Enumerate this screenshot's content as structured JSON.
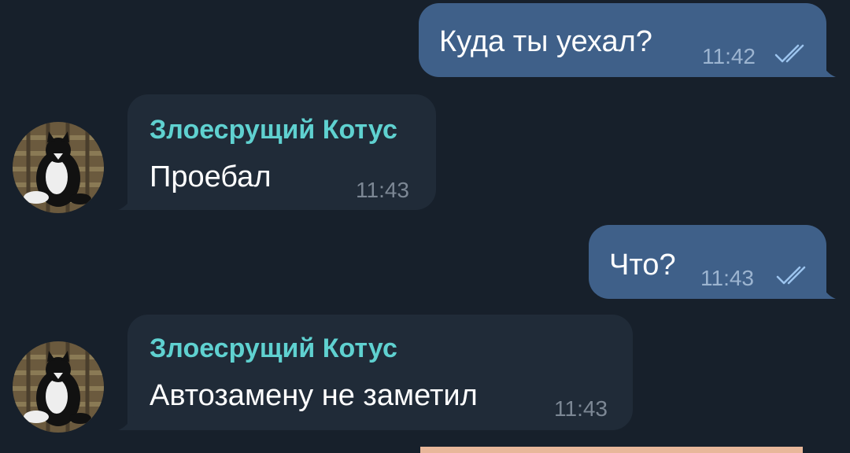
{
  "messages": [
    {
      "direction": "outgoing",
      "text": "Куда ты уехал?",
      "time": "11:42",
      "status": "read"
    },
    {
      "direction": "incoming",
      "sender": "Злоесрущий Котус",
      "text": "Проебал",
      "time": "11:43",
      "avatar_icon": "cat-avatar-icon"
    },
    {
      "direction": "outgoing",
      "text": "Что?",
      "time": "11:43",
      "status": "read"
    },
    {
      "direction": "incoming",
      "sender": "Злоесрущий Котус",
      "text": "Автозамену не заметил",
      "time": "11:43",
      "avatar_icon": "cat-avatar-icon"
    }
  ],
  "colors": {
    "background": "#17202b",
    "outgoing_bubble": "#3f6089",
    "incoming_bubble": "#202b38",
    "sender_name": "#5fd1d0"
  }
}
